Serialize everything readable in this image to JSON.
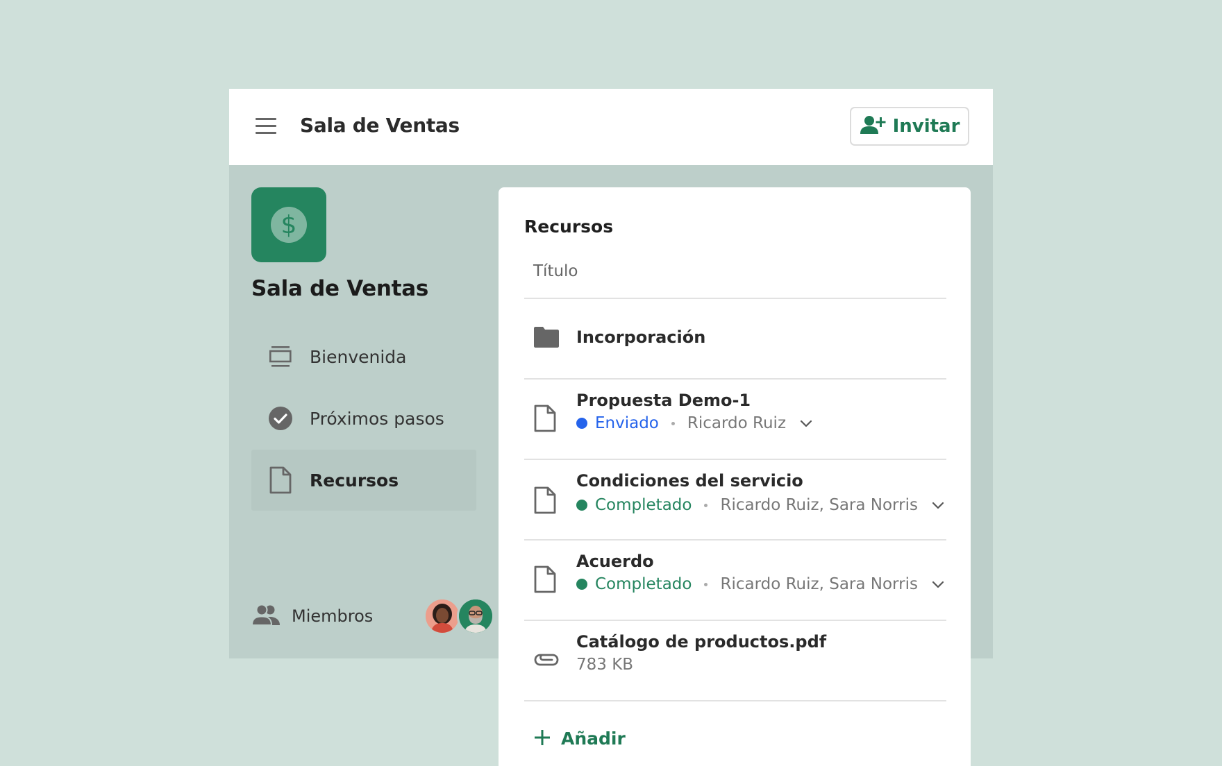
{
  "header": {
    "title": "Sala de Ventas",
    "invite_label": "Invitar"
  },
  "sidebar": {
    "room_name": "Sala de Ventas",
    "logo_symbol": "$",
    "items": [
      {
        "label": "Bienvenida",
        "icon": "welcome-icon"
      },
      {
        "label": "Próximos pasos",
        "icon": "check-circle-icon"
      },
      {
        "label": "Recursos",
        "icon": "document-icon",
        "active": true
      }
    ],
    "members_label": "Miembros"
  },
  "resources": {
    "title": "Recursos",
    "column_header": "Título",
    "rows": [
      {
        "name": "Incorporación",
        "type": "folder"
      },
      {
        "name": "Propuesta Demo-1",
        "type": "document",
        "status": "Enviado",
        "status_color": "#2563eb",
        "people": "Ricardo Ruiz"
      },
      {
        "name": "Condiciones del servicio",
        "type": "document",
        "status": "Completado",
        "status_color": "#25855f",
        "people": "Ricardo Ruiz, Sara Norris"
      },
      {
        "name": "Acuerdo",
        "type": "document",
        "status": "Completado",
        "status_color": "#25855f",
        "people": "Ricardo Ruiz, Sara Norris"
      },
      {
        "name": "Catálogo de productos.pdf",
        "type": "attachment",
        "size": "783 KB"
      }
    ],
    "add_label": "Añadir"
  },
  "colors": {
    "brand_green": "#25855f",
    "sent_blue": "#2563eb",
    "background": "#cfe0da"
  }
}
